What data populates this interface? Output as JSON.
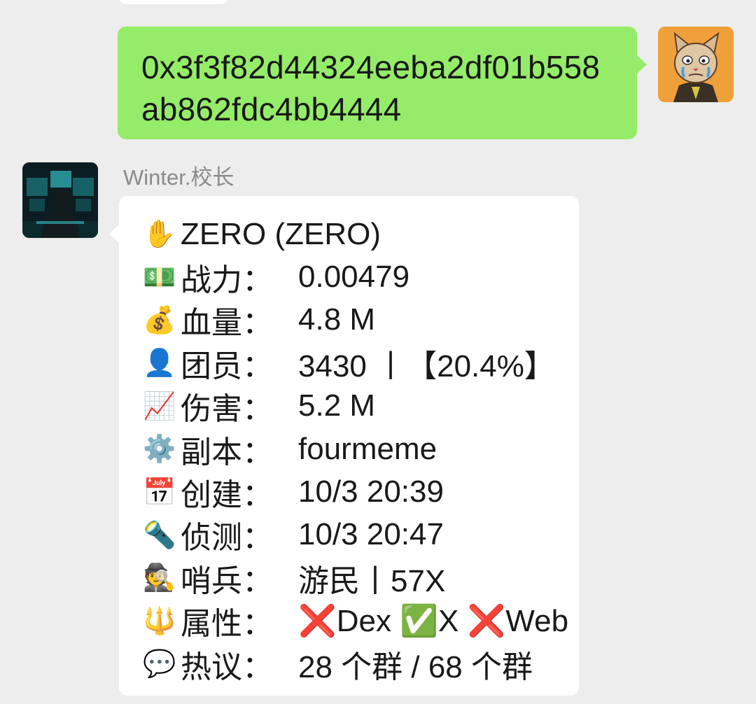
{
  "chat": {
    "outgoing": {
      "address_line1": "0x3f3f82d44324eeba2df01b558",
      "address_line2": "ab862fdc4bb4444"
    },
    "incoming": {
      "sender": "Winter.校长",
      "title_emoji": "✋",
      "title": "ZERO (ZERO)",
      "rows": [
        {
          "emoji": "💵",
          "key": "战力：",
          "value": "0.00479"
        },
        {
          "emoji": "💰",
          "key": "血量：",
          "value": "4.8 M"
        },
        {
          "emoji": "👤",
          "key": "团员：",
          "value": "3430 丨【20.4%】"
        },
        {
          "emoji": "📈",
          "key": "伤害：",
          "value": "5.2 M"
        },
        {
          "emoji": "⚙️",
          "key": "副本：",
          "value": "fourmeme"
        },
        {
          "emoji": "📅",
          "key": "创建：",
          "value": "10/3 20:39"
        },
        {
          "emoji": "🔦",
          "key": "侦测：",
          "value": "10/3 20:47"
        },
        {
          "emoji": "🕵",
          "key": "哨兵：",
          "value": "游民丨57X"
        },
        {
          "emoji": "🔱",
          "key": "属性：",
          "value": "❌Dex ✅X ❌Web"
        },
        {
          "emoji": "💬",
          "key": "热议：",
          "value": "28 个群 / 68 个群"
        }
      ]
    }
  },
  "colors": {
    "background": "#ededed",
    "outgoing_bubble": "#95ec69",
    "incoming_bubble": "#ffffff",
    "sender_name": "#8a8a8a",
    "text": "#191919"
  },
  "icons": {
    "self_avatar": "cartoon-cat-avatar",
    "other_avatar": "hacker-monitors-avatar"
  }
}
